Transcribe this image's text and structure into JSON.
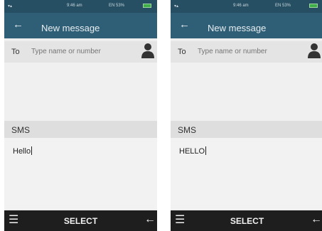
{
  "screens": [
    {
      "status_time": "9:46 am",
      "status_network": "EN 53%",
      "title": "New message",
      "to_label": "To",
      "to_placeholder": "Type name or number",
      "sms_label": "SMS",
      "message_text": "Hello",
      "softkey_center": "SELECT"
    },
    {
      "status_time": "9:46 am",
      "status_network": "EN 53%",
      "title": "New message",
      "to_label": "To",
      "to_placeholder": "Type name or number",
      "sms_label": "SMS",
      "message_text": "HELLO",
      "softkey_center": "SELECT"
    }
  ],
  "icons": {
    "back": "arrow-left-icon",
    "contact": "person-icon",
    "menu": "menu-icon",
    "backspace": "backspace-icon"
  },
  "colors": {
    "status_bar": "#264f63",
    "app_bar": "#2f5f76",
    "battery": "#3fae49",
    "softkey_bar": "#1e1e1e"
  }
}
